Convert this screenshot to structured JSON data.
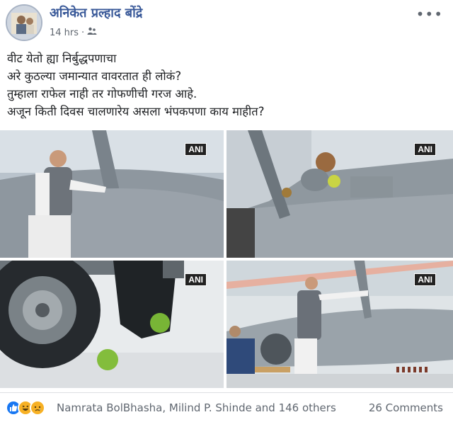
{
  "post": {
    "author_name": "अनिकेत प्रल्हाद बोंद्रे",
    "timestamp": "14 hrs",
    "privacy_icon": "friends-icon",
    "more_icon": "more-options-icon",
    "text_lines": [
      "वीट येतो ह्या निर्बुद्धपणाचा",
      "अरे कुठल्या जमान्यात वावरतात ही लोकं?",
      "तुम्हाला राफेल नाही तर गोफणीची गरज आहे.",
      "अजून किती दिवस चालणारेय असला भंपकपणा काय माहीत?"
    ]
  },
  "photos": [
    {
      "watermark": "ANI"
    },
    {
      "watermark": "ANI"
    },
    {
      "watermark": "ANI"
    },
    {
      "watermark": "ANI"
    }
  ],
  "footer": {
    "reaction_icons": [
      "like-icon",
      "haha-icon",
      "sad-icon"
    ],
    "reactors_text": "Namrata BolBhasha, Milind P. Shinde and 146 others",
    "comments_text": "26 Comments"
  },
  "colors": {
    "link": "#385898",
    "secondary_text": "#606770",
    "like_blue": "#1877f2"
  }
}
